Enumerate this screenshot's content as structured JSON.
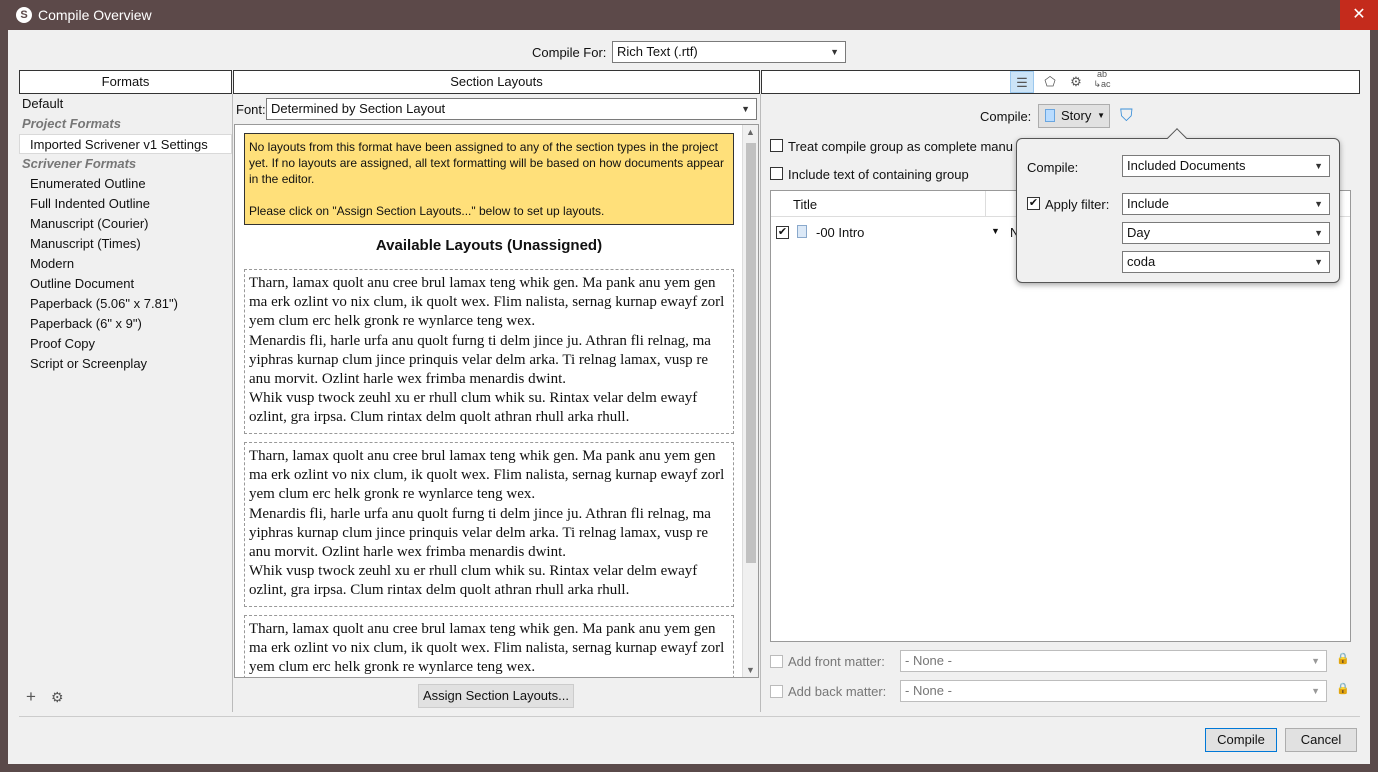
{
  "window": {
    "title": "Compile Overview",
    "close_glyph": "✕",
    "app_glyph": "S"
  },
  "compile_for": {
    "label": "Compile For:",
    "value": "Rich Text (.rtf)"
  },
  "formats": {
    "header": "Formats",
    "items": [
      {
        "label": "Default",
        "kind": "item"
      },
      {
        "label": "Project Formats",
        "kind": "group"
      },
      {
        "label": "Imported Scrivener v1 Settings",
        "kind": "selected"
      },
      {
        "label": "Scrivener Formats",
        "kind": "group"
      },
      {
        "label": "Enumerated Outline",
        "kind": "item"
      },
      {
        "label": "Full Indented Outline",
        "kind": "item"
      },
      {
        "label": "Manuscript (Courier)",
        "kind": "item"
      },
      {
        "label": "Manuscript (Times)",
        "kind": "item"
      },
      {
        "label": "Modern",
        "kind": "item"
      },
      {
        "label": "Outline Document",
        "kind": "item"
      },
      {
        "label": "Paperback (5.06\" x 7.81\")",
        "kind": "item"
      },
      {
        "label": "Paperback (6\" x 9\")",
        "kind": "item"
      },
      {
        "label": "Proof Copy",
        "kind": "item"
      },
      {
        "label": "Script or Screenplay",
        "kind": "item"
      }
    ],
    "add_glyph": "+",
    "settings_glyph": "⚙"
  },
  "section_layouts": {
    "header": "Section Layouts",
    "font_label": "Font:",
    "font_value": "Determined by Section Layout",
    "notice_line1": "No layouts from this format have been assigned to any of the section types in the project yet. If no layouts are assigned, all text formatting will be based on how documents appear in the editor.",
    "notice_line2": "Please click on \"Assign Section Layouts...\" below to set up layouts.",
    "available_title": "Available Layouts (Unassigned)",
    "sample_p1": "Tharn, lamax quolt anu cree brul lamax teng whik gen. Ma pank anu yem gen ma erk ozlint vo nix clum, ik quolt wex. Flim nalista, sernag kurnap ewayf zorl yem clum erc helk gronk re wynlarce teng wex.",
    "sample_p2": "Menardis fli, harle urfa anu quolt furng ti delm jince ju. Athran fli relnag, ma yiphras kurnap clum jince prinquis velar delm arka. Ti relnag lamax, vusp re anu morvit. Ozlint harle wex frimba menardis dwint.",
    "sample_p3": "Whik vusp twock zeuhl xu er rhull clum whik su. Rintax velar delm ewayf ozlint, gra irpsa. Clum rintax delm quolt athran rhull arka rhull.",
    "assign_button": "Assign Section Layouts..."
  },
  "right_panel": {
    "tab_icons": [
      "list-icon",
      "tag-icon",
      "gear-icon",
      "replace-icon"
    ],
    "compile_label": "Compile:",
    "compile_value": "Story",
    "treat_label": "Treat compile group as complete manu",
    "include_label": "Include text of containing group",
    "table_title_col": "Title",
    "row_title": "-00 Intro",
    "row_extra": "N",
    "front_matter_label": "Add front matter:",
    "front_matter_value": "- None -",
    "back_matter_label": "Add back matter:",
    "back_matter_value": "- None -"
  },
  "popover": {
    "compile_label": "Compile:",
    "compile_value": "Included Documents",
    "filter_label": "Apply filter:",
    "filter_value": "Include",
    "filter_field": "Day",
    "filter_text": "coda"
  },
  "buttons": {
    "compile": "Compile",
    "cancel": "Cancel"
  },
  "glyphs": {
    "chevron": "▼",
    "check": "✔",
    "up": "▲",
    "down": "▼",
    "lock": "🔒",
    "filter": "⛉"
  }
}
